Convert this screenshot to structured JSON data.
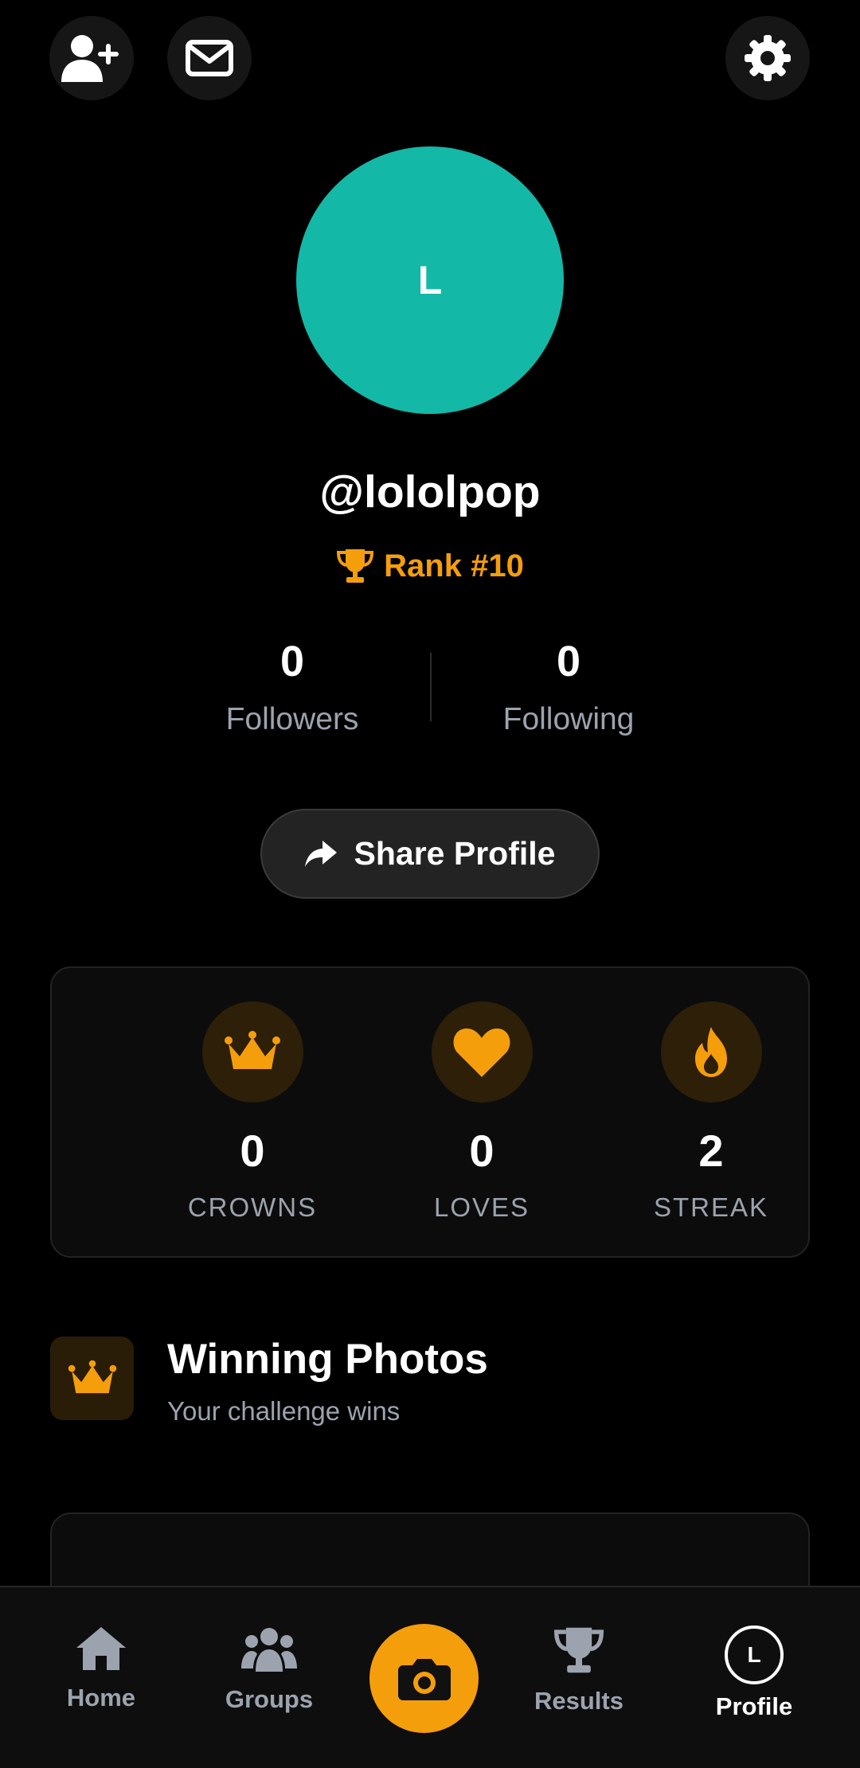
{
  "header": {
    "add_friend_icon": "user-plus-icon",
    "messages_icon": "envelope-icon",
    "settings_icon": "gear-icon"
  },
  "profile": {
    "avatar_initial": "L",
    "avatar_color": "#14b8a6",
    "username": "@lololpop",
    "rank": "Rank #10"
  },
  "follow": {
    "followers_count": "0",
    "followers_label": "Followers",
    "following_count": "0",
    "following_label": "Following"
  },
  "share_button": {
    "label": "Share Profile"
  },
  "stats": [
    {
      "icon": "crown-icon",
      "value": "0",
      "label": "CROWNS"
    },
    {
      "icon": "heart-icon",
      "value": "0",
      "label": "LOVES"
    },
    {
      "icon": "flame-icon",
      "value": "2",
      "label": "STREAK"
    }
  ],
  "winning_section": {
    "title": "Winning Photos",
    "subtitle": "Your challenge wins"
  },
  "nav": {
    "home": "Home",
    "groups": "Groups",
    "results": "Results",
    "profile": "Profile",
    "profile_initial": "L",
    "accent": "#f59e0b"
  }
}
